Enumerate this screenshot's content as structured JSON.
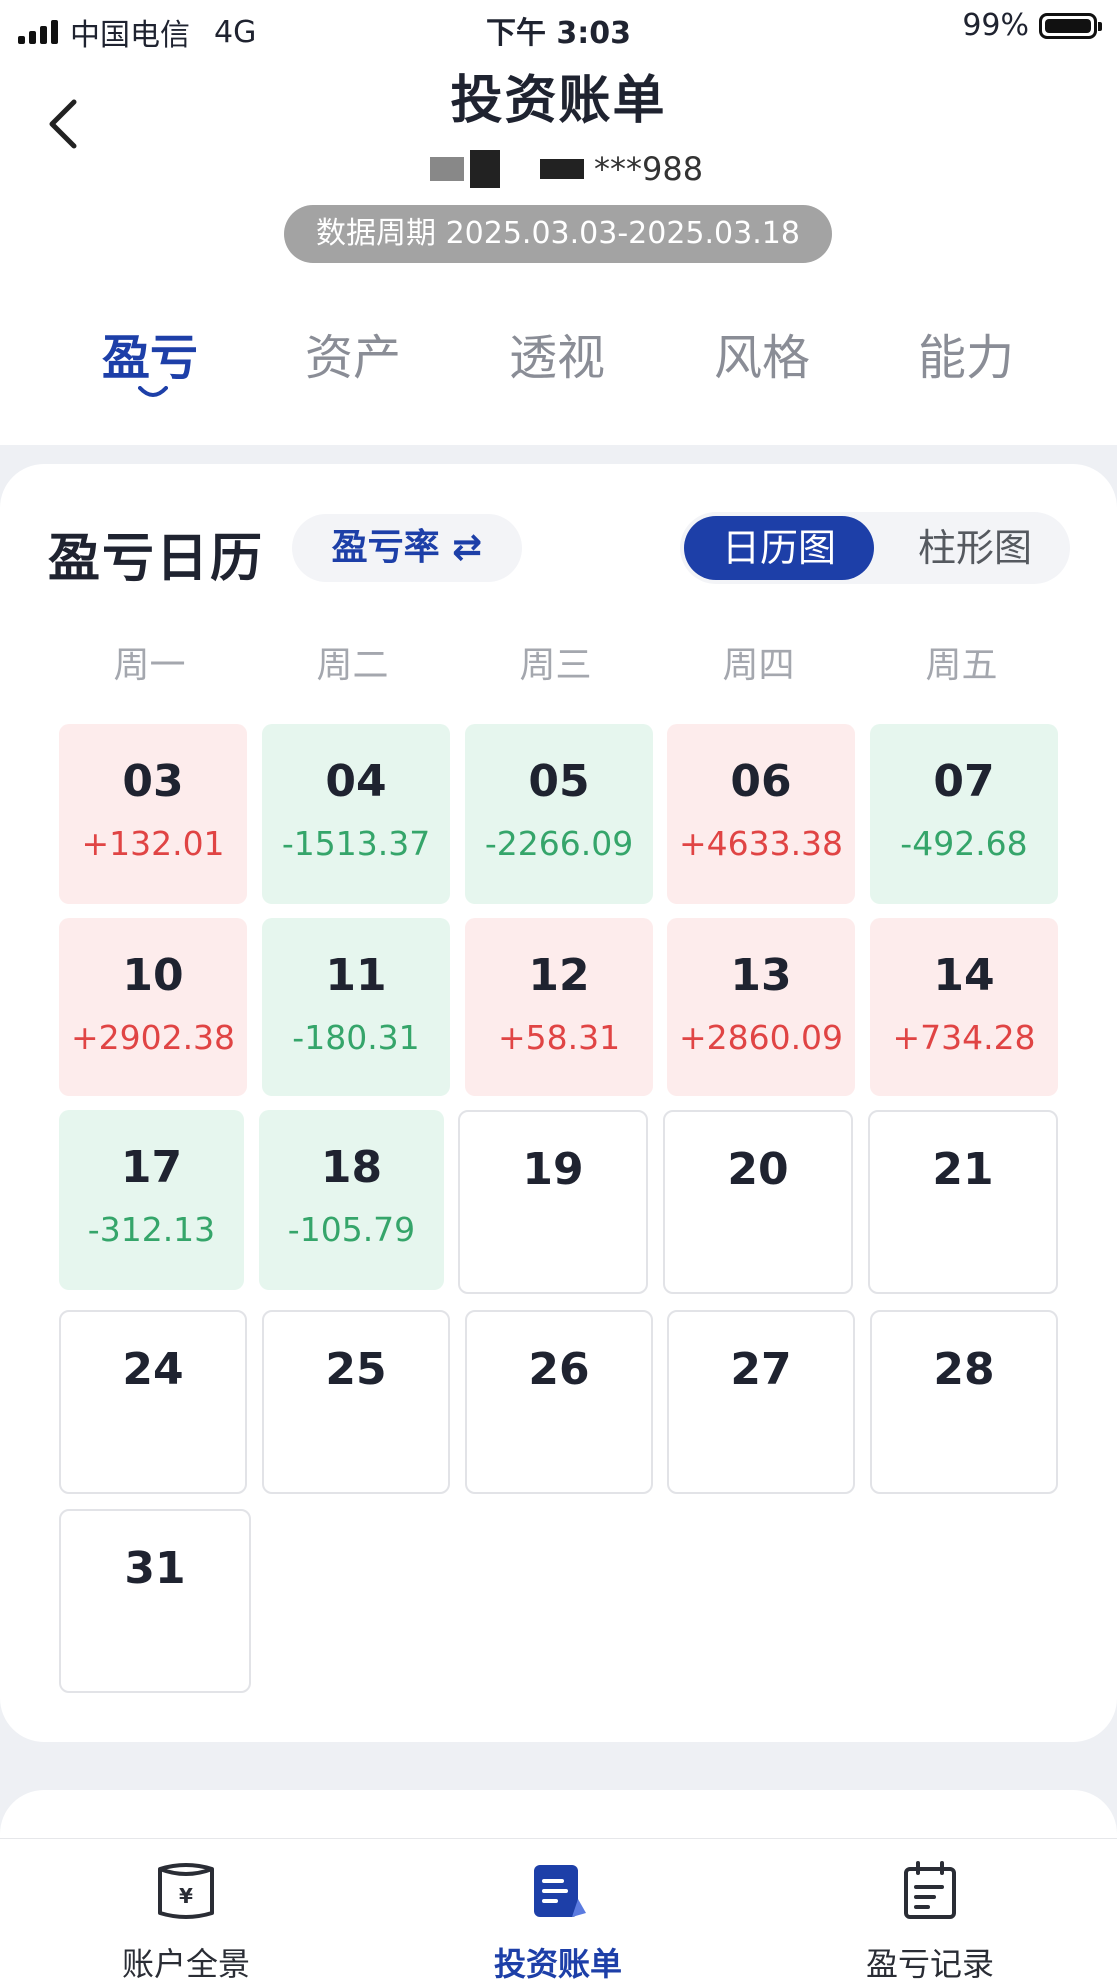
{
  "status": {
    "carrier": "中国电信",
    "network": "4G",
    "time": "下午 3:03",
    "battery": "99%"
  },
  "header": {
    "title": "投资账单",
    "account_suffix": "***988",
    "period": "数据周期 2025.03.03-2025.03.18"
  },
  "tabs": [
    {
      "label": "盈亏",
      "active": true
    },
    {
      "label": "资产",
      "active": false
    },
    {
      "label": "透视",
      "active": false
    },
    {
      "label": "风格",
      "active": false
    },
    {
      "label": "能力",
      "active": false
    }
  ],
  "calendar": {
    "title": "盈亏日历",
    "metric_toggle": "盈亏率 ⇄",
    "view_options": {
      "calendar": "日历图",
      "bar": "柱形图",
      "selected": "日历图"
    },
    "weekdays": [
      "周一",
      "周二",
      "周三",
      "周四",
      "周五"
    ],
    "weeks": [
      [
        {
          "day": "03",
          "value": "+132.01"
        },
        {
          "day": "04",
          "value": "-1513.37"
        },
        {
          "day": "05",
          "value": "-2266.09"
        },
        {
          "day": "06",
          "value": "+4633.38"
        },
        {
          "day": "07",
          "value": "-492.68"
        }
      ],
      [
        {
          "day": "10",
          "value": "+2902.38"
        },
        {
          "day": "11",
          "value": "-180.31"
        },
        {
          "day": "12",
          "value": "+58.31"
        },
        {
          "day": "13",
          "value": "+2860.09"
        },
        {
          "day": "14",
          "value": "+734.28"
        }
      ],
      [
        {
          "day": "17",
          "value": "-312.13"
        },
        {
          "day": "18",
          "value": "-105.79"
        },
        {
          "day": "19",
          "value": ""
        },
        {
          "day": "20",
          "value": ""
        },
        {
          "day": "21",
          "value": ""
        }
      ],
      [
        {
          "day": "24",
          "value": ""
        },
        {
          "day": "25",
          "value": ""
        },
        {
          "day": "26",
          "value": ""
        },
        {
          "day": "27",
          "value": ""
        },
        {
          "day": "28",
          "value": ""
        }
      ],
      [
        {
          "day": "31",
          "value": ""
        }
      ]
    ],
    "colors": {
      "profit": "#e04444",
      "loss": "#35a56a",
      "profit_bg": "#fdecec",
      "loss_bg": "#e6f6ee"
    }
  },
  "bottom_nav": [
    {
      "label": "账户全景",
      "icon": "wallet-icon",
      "active": false
    },
    {
      "label": "投资账单",
      "icon": "bill-icon",
      "active": true
    },
    {
      "label": "盈亏记录",
      "icon": "calendar-record-icon",
      "active": false
    }
  ],
  "accent": "#1d3fa8"
}
